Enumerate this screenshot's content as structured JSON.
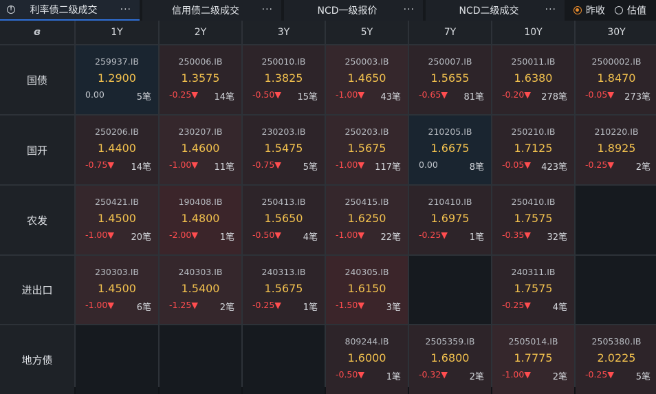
{
  "tabs": [
    {
      "label": "利率债二级成交",
      "active": true
    },
    {
      "label": "信用债二级成交",
      "active": false
    },
    {
      "label": "NCD一级报价",
      "active": false
    },
    {
      "label": "NCD二级成交",
      "active": false
    }
  ],
  "radio": {
    "options": [
      "昨收",
      "估值"
    ],
    "selected": "昨收"
  },
  "tenors": [
    "1Y",
    "2Y",
    "3Y",
    "5Y",
    "7Y",
    "10Y",
    "30Y"
  ],
  "colors": {
    "up": "#ff4d4f",
    "rate": "#f2c14e",
    "active_tab": "#2f6fd6",
    "radio": "#e88b2c"
  },
  "rows": [
    {
      "name": "国债",
      "cells": [
        {
          "code": "259937.IB",
          "rate": "1.2900",
          "change": "0.00",
          "count": "5笔",
          "tone": "neutral"
        },
        {
          "code": "250006.IB",
          "rate": "1.3575",
          "change": "-0.25▼",
          "count": "14笔",
          "tone": "red1"
        },
        {
          "code": "250010.IB",
          "rate": "1.3825",
          "change": "-0.50▼",
          "count": "15笔",
          "tone": "red1"
        },
        {
          "code": "250003.IB",
          "rate": "1.4650",
          "change": "-1.00▼",
          "count": "43笔",
          "tone": "red2"
        },
        {
          "code": "250007.IB",
          "rate": "1.5655",
          "change": "-0.65▼",
          "count": "81笔",
          "tone": "red1"
        },
        {
          "code": "250011.IB",
          "rate": "1.6380",
          "change": "-0.20▼",
          "count": "278笔",
          "tone": "red1"
        },
        {
          "code": "2500002.IB",
          "rate": "1.8470",
          "change": "-0.05▼",
          "count": "273笔",
          "tone": "red1"
        }
      ]
    },
    {
      "name": "国开",
      "cells": [
        {
          "code": "250206.IB",
          "rate": "1.4400",
          "change": "-0.75▼",
          "count": "14笔",
          "tone": "red1"
        },
        {
          "code": "230207.IB",
          "rate": "1.4600",
          "change": "-1.00▼",
          "count": "11笔",
          "tone": "red2"
        },
        {
          "code": "230203.IB",
          "rate": "1.5475",
          "change": "-0.75▼",
          "count": "5笔",
          "tone": "red1"
        },
        {
          "code": "250203.IB",
          "rate": "1.5675",
          "change": "-1.00▼",
          "count": "117笔",
          "tone": "red2"
        },
        {
          "code": "210205.IB",
          "rate": "1.6675",
          "change": "0.00",
          "count": "8笔",
          "tone": "neutral"
        },
        {
          "code": "250210.IB",
          "rate": "1.7125",
          "change": "-0.05▼",
          "count": "423笔",
          "tone": "red1"
        },
        {
          "code": "210220.IB",
          "rate": "1.8925",
          "change": "-0.25▼",
          "count": "2笔",
          "tone": "red1"
        }
      ]
    },
    {
      "name": "农发",
      "cells": [
        {
          "code": "250421.IB",
          "rate": "1.4500",
          "change": "-1.00▼",
          "count": "20笔",
          "tone": "red2"
        },
        {
          "code": "190408.IB",
          "rate": "1.4800",
          "change": "-2.00▼",
          "count": "1笔",
          "tone": "red3"
        },
        {
          "code": "250413.IB",
          "rate": "1.5650",
          "change": "-0.50▼",
          "count": "4笔",
          "tone": "red1"
        },
        {
          "code": "250415.IB",
          "rate": "1.6250",
          "change": "-1.00▼",
          "count": "22笔",
          "tone": "red2"
        },
        {
          "code": "210410.IB",
          "rate": "1.6975",
          "change": "-0.25▼",
          "count": "1笔",
          "tone": "red1"
        },
        {
          "code": "250410.IB",
          "rate": "1.7575",
          "change": "-0.35▼",
          "count": "32笔",
          "tone": "red1"
        },
        {
          "empty": true
        }
      ]
    },
    {
      "name": "进出口",
      "cells": [
        {
          "code": "230303.IB",
          "rate": "1.4500",
          "change": "-1.00▼",
          "count": "6笔",
          "tone": "red2"
        },
        {
          "code": "240303.IB",
          "rate": "1.5400",
          "change": "-1.25▼",
          "count": "2笔",
          "tone": "red2"
        },
        {
          "code": "240313.IB",
          "rate": "1.5675",
          "change": "-0.25▼",
          "count": "1笔",
          "tone": "red1"
        },
        {
          "code": "240305.IB",
          "rate": "1.6150",
          "change": "-1.50▼",
          "count": "3笔",
          "tone": "red3"
        },
        {
          "empty": true
        },
        {
          "code": "240311.IB",
          "rate": "1.7575",
          "change": "-0.25▼",
          "count": "4笔",
          "tone": "red1"
        },
        {
          "empty": true
        }
      ]
    },
    {
      "name": "地方债",
      "cells": [
        {
          "empty": true
        },
        {
          "empty": true
        },
        {
          "empty": true
        },
        {
          "code": "809244.IB",
          "rate": "1.6000",
          "change": "-0.50▼",
          "count": "1笔",
          "tone": "red1"
        },
        {
          "code": "2505359.IB",
          "rate": "1.6800",
          "change": "-0.32▼",
          "count": "2笔",
          "tone": "red1"
        },
        {
          "code": "2505014.IB",
          "rate": "1.7775",
          "change": "-1.00▼",
          "count": "2笔",
          "tone": "red2"
        },
        {
          "code": "2505380.IB",
          "rate": "2.0225",
          "change": "-0.25▼",
          "count": "5笔",
          "tone": "red1"
        }
      ]
    }
  ]
}
